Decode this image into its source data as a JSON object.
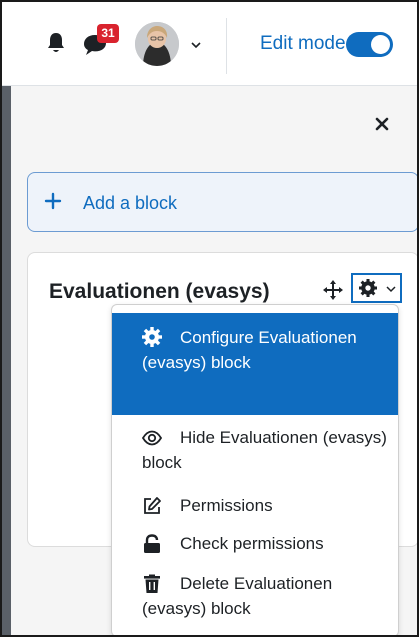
{
  "header": {
    "notification_icon": "bell-icon",
    "messages_icon": "chat-icon",
    "messages_badge": "31",
    "user_menu_chevron": "chevron-down-icon",
    "edit_mode_label": "Edit mode",
    "edit_mode_on": true
  },
  "drawer": {
    "close_icon": "close-icon",
    "add_block_label": "Add a block"
  },
  "block": {
    "title": "Evaluationen (evasys)",
    "move_icon": "move-icon",
    "actions_icon": "gear-icon"
  },
  "menu": {
    "items": [
      {
        "icon": "gear-icon",
        "label": "Configure Evaluationen (evasys) block",
        "active": true
      },
      {
        "icon": "eye-icon",
        "label": "Hide Evaluationen (evasys) block",
        "active": false
      },
      {
        "icon": "pencil-square-icon",
        "label": "Permissions",
        "active": false
      },
      {
        "icon": "unlock-icon",
        "label": "Check permissions",
        "active": false
      },
      {
        "icon": "trash-icon",
        "label": "Delete Evaluationen (evasys) block",
        "active": false
      }
    ]
  },
  "colors": {
    "accent": "#0f6cbf",
    "badge": "#d9232e"
  }
}
